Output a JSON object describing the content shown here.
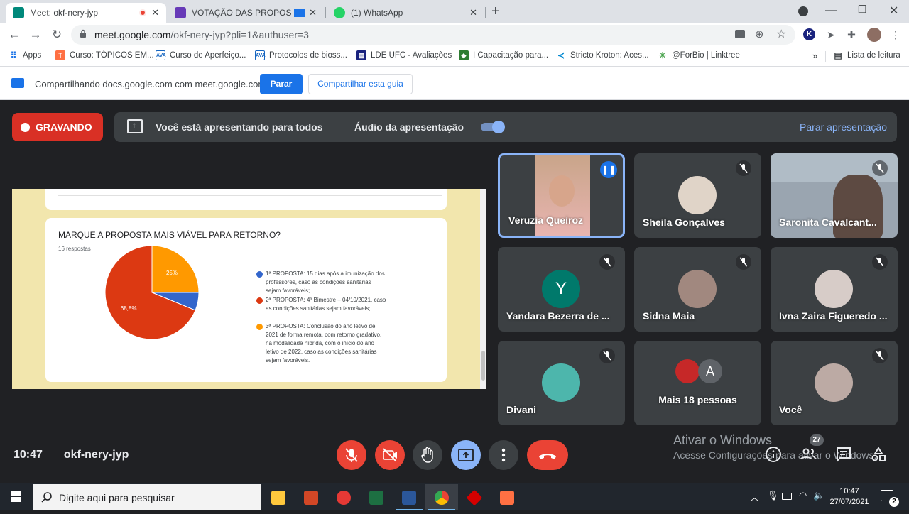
{
  "browser": {
    "tabs": [
      {
        "title": "Meet: okf-nery-jyp",
        "favicon_color": "#00897b"
      },
      {
        "title": "VOTAÇÃO DAS PROPOSTAS",
        "favicon_color": "#673ab7"
      },
      {
        "title": "(1) WhatsApp",
        "favicon_color": "#25d366"
      }
    ],
    "new_tab": "+",
    "url_host": "meet.google.com",
    "url_path": "/okf-nery-jyp?pli=1&authuser=3",
    "profile_initial": "K"
  },
  "bookmarks": {
    "items": [
      {
        "label": "Apps"
      },
      {
        "label": "Curso: TÓPICOS EM..."
      },
      {
        "label": "Curso de Aperfeiço..."
      },
      {
        "label": "Protocolos de bioss..."
      },
      {
        "label": "LDE UFC - Avaliações"
      },
      {
        "label": "I Capacitação para..."
      },
      {
        "label": "Stricto Kroton: Aces..."
      },
      {
        "label": "@ForBio | Linktree"
      }
    ],
    "more": "»",
    "reading_list": "Lista de leitura"
  },
  "share_bar": {
    "text": "Compartilhando docs.google.com com meet.google.com",
    "stop_label": "Parar",
    "share_tab_label": "Compartilhar esta guia"
  },
  "meet": {
    "recording_label": "GRAVANDO",
    "presenting_text": "Você está apresentando para todos",
    "audio_label": "Áudio da apresentação",
    "audio_on": true,
    "stop_presenting": "Parar apresentação",
    "meeting_time": "10:47",
    "meeting_code": "okf-nery-jyp",
    "people_count": "27",
    "watermark_title": "Ativar o Windows",
    "watermark_sub": "Acesse Configurações para ativar o Windows."
  },
  "form": {
    "question": "MARQUE A PROPOSTA MAIS VIÁVEL PARA RETORNO?",
    "responses": "16 respostas"
  },
  "chart_data": {
    "type": "pie",
    "title": "MARQUE A PROPOSTA MAIS VIÁVEL PARA RETORNO?",
    "slices": [
      {
        "label": "1ª PROPOSTA: 15 dias após a imunização dos professores, caso as condições sanitárias sejam favoráveis;",
        "value": 6.2,
        "color": "#3366cc"
      },
      {
        "label": "2ª PROPOSTA: 4º Bimestre – 04/10/2021, caso as condições sanitárias sejam favoráveis;",
        "value": 68.8,
        "color": "#dc3912"
      },
      {
        "label": "3ª PROPOSTA: Conclusão do ano letivo de 2021 de forma remota, com retorno gradativo, na modalidade híbrida, com o início do ano letivo de 2022, caso as condições sanitárias sejam favoráveis.",
        "value": 25,
        "color": "#ff9900"
      }
    ],
    "data_labels": [
      "",
      "68,8%",
      "25%"
    ]
  },
  "participants": [
    {
      "name": "Veruzia Queiroz",
      "speaking": true
    },
    {
      "name": "Sheila Gonçalves",
      "muted": true
    },
    {
      "name": "Saronita Cavalcant...",
      "muted": true
    },
    {
      "name": "Yandara Bezerra de ...",
      "initial": "Y",
      "muted": true
    },
    {
      "name": "Sidna Maia",
      "muted": true
    },
    {
      "name": "Ivna Zaira Figueredo ...",
      "muted": true
    },
    {
      "name": "Divani",
      "muted": true
    },
    {
      "name": "Mais 18 pessoas",
      "initial": "A"
    },
    {
      "name": "Você",
      "muted": true
    }
  ],
  "taskbar": {
    "search_placeholder": "Digite aqui para pesquisar",
    "time": "10:47",
    "date": "27/07/2021",
    "notifications": "2"
  }
}
